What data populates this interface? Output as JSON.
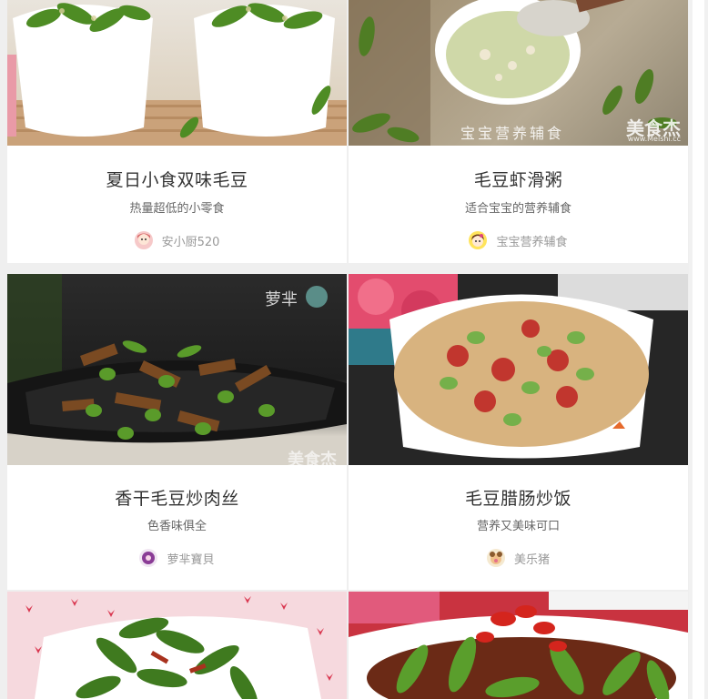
{
  "recipes": [
    {
      "title": "夏日小食双味毛豆",
      "subtitle": "热量超低的小零食",
      "author": "安小厨520",
      "image": "edamame-two-cups-photo"
    },
    {
      "title": "毛豆虾滑粥",
      "subtitle": "适合宝宝的营养辅食",
      "author": "宝宝营养辅食",
      "image": "edamame-shrimp-porridge-photo",
      "overlay_text": "宝宝营养辅食",
      "watermark": "美食杰",
      "watermark_sub": "www.Meishi.cc"
    },
    {
      "title": "香干毛豆炒肉丝",
      "subtitle": "色香味俱全",
      "author": "萝芈寶貝",
      "image": "stirfry-tofu-edamame-photo",
      "overlay_text": "萝芈",
      "watermark": "美食杰"
    },
    {
      "title": "毛豆腊肠炒饭",
      "subtitle": "营养又美味可口",
      "author": "美乐猪",
      "image": "edamame-sausage-fried-rice-photo"
    },
    {
      "title": "",
      "subtitle": "",
      "author": "",
      "image": "spicy-edamame-plate-photo"
    },
    {
      "title": "",
      "subtitle": "",
      "author": "",
      "image": "chili-edamame-photo"
    }
  ]
}
